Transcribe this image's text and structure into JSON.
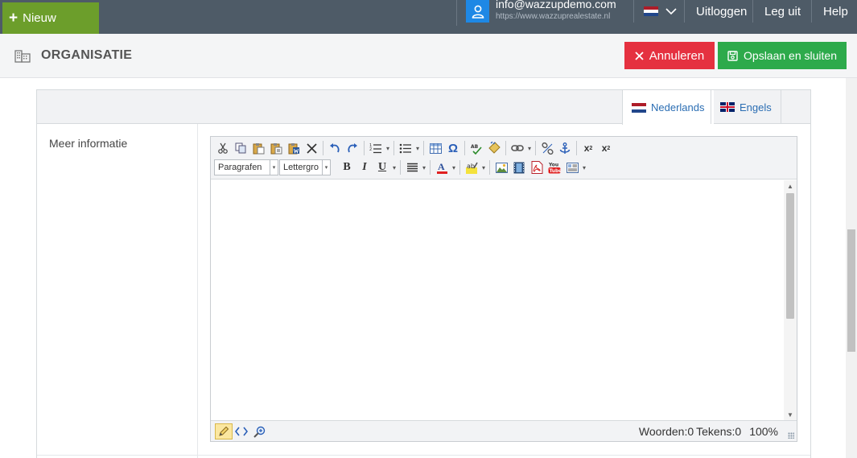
{
  "topbar": {
    "new_label": "Nieuw",
    "user_email": "info@wazzupdemo.com",
    "user_site": "https://www.wazzuprealestate.nl",
    "links": {
      "uitloggen": "Uitloggen",
      "leg_uit": "Leg uit",
      "help": "Help"
    }
  },
  "header": {
    "title": "ORGANISATIE",
    "cancel_label": "Annuleren",
    "save_label": "Opslaan en sluiten"
  },
  "language_tabs": [
    {
      "label": "Nederlands",
      "flag": "nl",
      "active": true
    },
    {
      "label": "Engels",
      "flag": "uk",
      "active": false
    }
  ],
  "field": {
    "label": "Meer informatie"
  },
  "editor": {
    "format_combo": "Paragrafen",
    "font_combo": "Lettergro",
    "content": "",
    "status": {
      "words": "Woorden:0",
      "chars": "Tekens:0",
      "zoom": "100%"
    }
  },
  "colors": {
    "topbar": "#4e5b67",
    "new_button": "#6c9e2b",
    "cancel": "#e53140",
    "save": "#2daa4b",
    "link": "#2a6db3"
  }
}
